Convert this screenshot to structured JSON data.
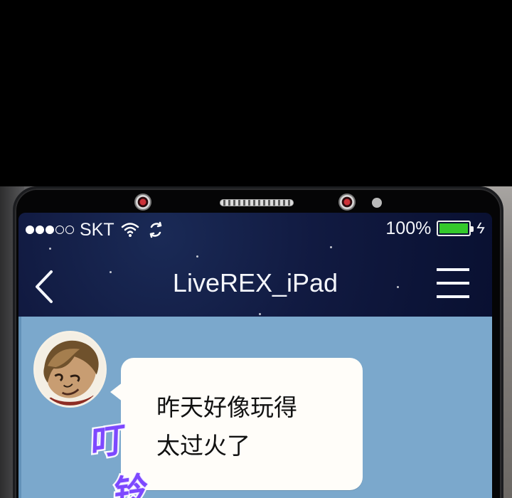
{
  "colors": {
    "phone_frame": "#050506",
    "nav_background": "#0e1434",
    "chat_background": "#7ba8cc",
    "bubble_background": "#fffdf9",
    "battery_green": "#34c92b",
    "sound_effect_purple": "#7d48ff"
  },
  "status_bar": {
    "signal_icon": "signal-dots-icon",
    "carrier": "SKT",
    "wifi_icon": "wifi-icon",
    "sync_icon": "sync-icon",
    "battery_text": "100%",
    "battery_level": 1,
    "charging_icon": "charging-bolt-icon"
  },
  "header": {
    "back_icon": "back-chevron-icon",
    "title": "LiveREX_iPad",
    "menu_icon": "hamburger-menu-icon"
  },
  "conversation": {
    "avatar": "person-avatar",
    "message_lines": [
      "昨天好像玩得",
      "太过火了"
    ]
  },
  "sound_effect": {
    "first": "叮",
    "second": "铃"
  }
}
